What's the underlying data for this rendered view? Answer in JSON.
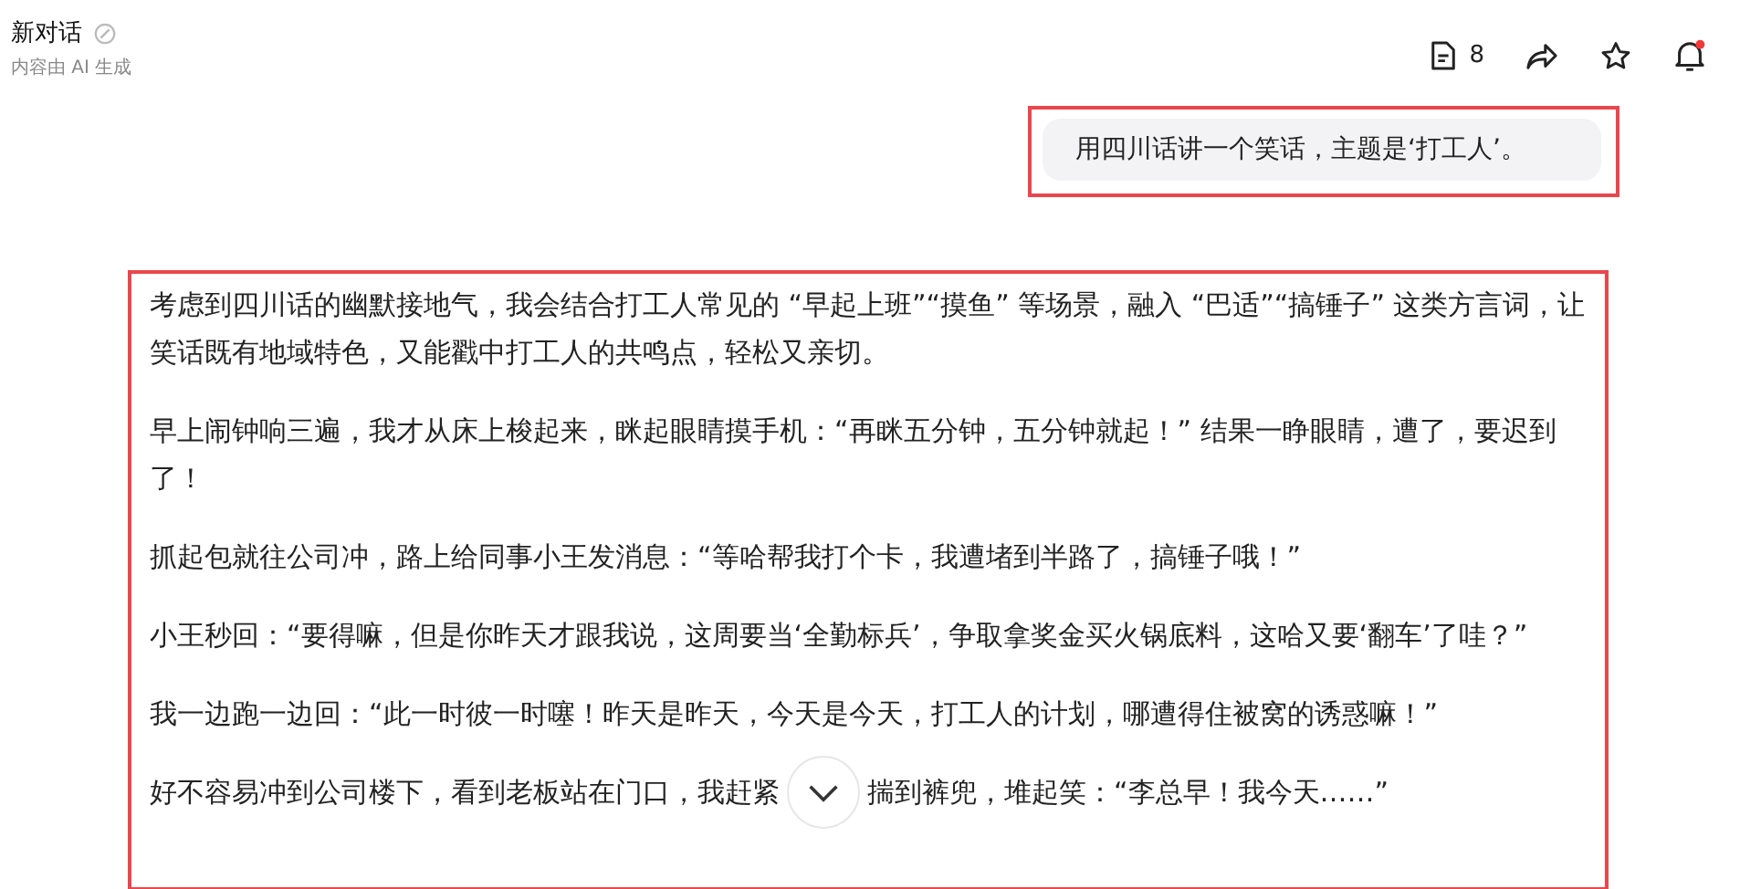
{
  "header": {
    "title": "新对话",
    "subtitle": "内容由 AI 生成",
    "doc_count": "8"
  },
  "user_message": "用四川话讲一个笑话，主题是‘打工人’。",
  "answer": {
    "paragraphs": [
      [
        "考虑到四川话的幽默接地气，我会结合打工人常见的 “早起上班”“摸鱼” 等场景，融入 “巴适”“搞锤子” 这类方言词，让笑话既有地域特色，又能戳中打工人的共鸣点，轻松又亲切。"
      ],
      [
        "早上闹钟响三遍，我才从床上梭起来，眯起眼睛摸手机：“再眯五分钟，五分钟就起！” 结果一睁眼睛，遭了，要迟到了！"
      ],
      [
        "抓起包就往公司冲，路上给同事小王发消息：“等哈帮我打个卡，我遭堵到半路了，搞锤子哦！”"
      ],
      [
        "小王秒回：“要得嘛，但是你昨天才跟我说，这周要当‘全勤标兵’，争取拿奖金买火锅底料，这哈又要‘翻车’了哇？”"
      ],
      [
        "我一边跑一边回：“此一时彼一时噻！昨天是昨天，今天是今天，打工人的计划，哪遭得住被窝的诱惑嘛！”"
      ],
      [
        "好不容易冲到公司楼下，看到老板站在门口，我赶紧",
        "揣到裤兜，堆起笑：“李总早！我今天……”"
      ]
    ]
  }
}
